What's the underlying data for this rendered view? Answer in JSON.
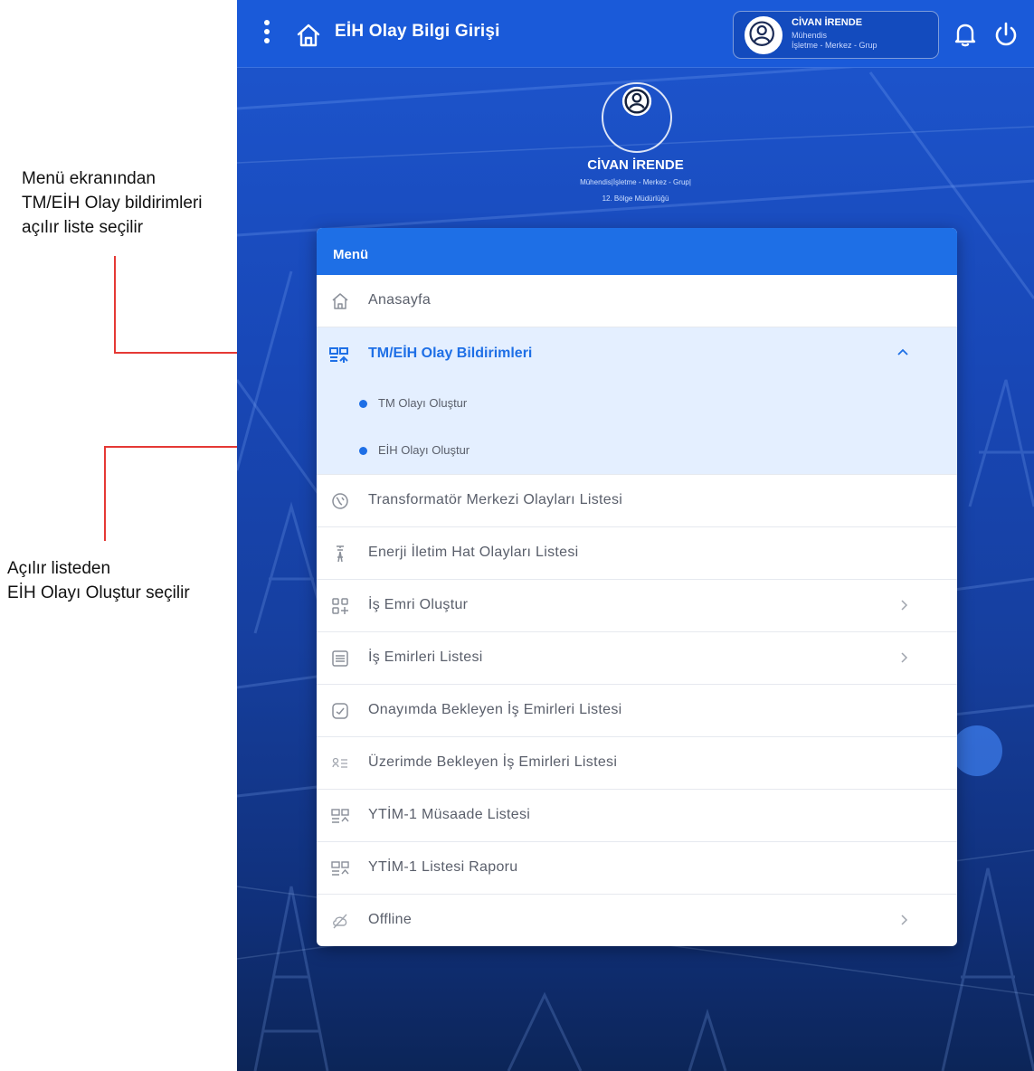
{
  "annotations": {
    "menu_note_line1": "Menü ekranından",
    "menu_note_line2": "TM/EİH Olay bildirimleri",
    "menu_note_line3": "açılır liste seçilir",
    "list_note_line1": "Açılır listeden",
    "list_note_line2": "EİH Olayı Oluştur seçilir"
  },
  "header": {
    "title": "EİH Olay Bilgi Girişi",
    "user_name": "CİVAN İRENDE",
    "user_role": "Mühendis",
    "user_unit": "İşletme - Merkez - Grup"
  },
  "profile": {
    "name": "CİVAN İRENDE",
    "role": "Mühendis|İşletme - Merkez - Grup|",
    "region": "12. Bölge Müdürlüğü"
  },
  "menu": {
    "title": "Menü",
    "home": "Anasayfa",
    "group_label": "TM/EİH Olay Bildirimleri",
    "sub_tm": "TM Olayı Oluştur",
    "sub_eih": "EİH Olayı Oluştur",
    "items": [
      {
        "label": "Transformatör Merkezi Olayları Listesi",
        "icon": "transformer-icon"
      },
      {
        "label": "Enerji İletim Hat Olayları Listesi",
        "icon": "pylon-icon"
      },
      {
        "label": "İş Emri Oluştur",
        "icon": "grid-plus-icon"
      },
      {
        "label": "İş Emirleri Listesi",
        "icon": "list-doc-icon"
      },
      {
        "label": "Onayımda Bekleyen İş Emirleri Listesi",
        "icon": "approval-icon"
      },
      {
        "label": "Üzerimde Bekleyen İş Emirleri Listesi",
        "icon": "assigned-list-icon"
      },
      {
        "label": "YTİM-1 Müsaade Listesi",
        "icon": "report-icon"
      },
      {
        "label": "YTİM-1 Listesi Raporu",
        "icon": "report-icon"
      },
      {
        "label": "Offline",
        "icon": "offline-icon"
      }
    ]
  },
  "colors": {
    "accent": "#1e6fe6",
    "annotation_line": "#e53935",
    "topbar": "#1a5ad9"
  }
}
